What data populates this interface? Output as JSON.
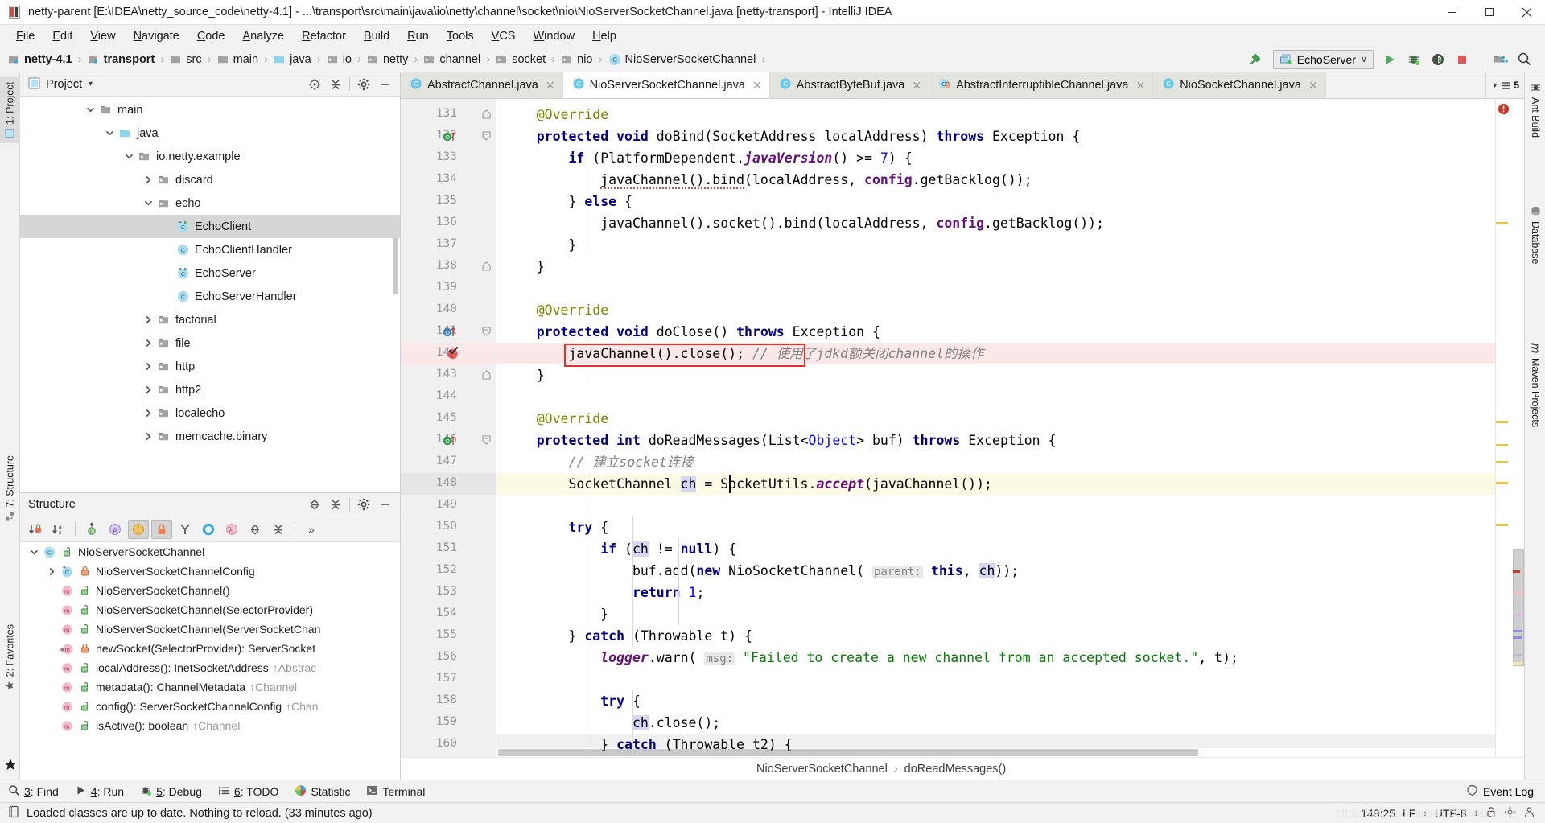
{
  "window": {
    "title": "netty-parent [E:\\IDEA\\netty_source_code\\netty-4.1] - ...\\transport\\src\\main\\java\\io\\netty\\channel\\socket\\nio\\NioServerSocketChannel.java [netty-transport] - IntelliJ IDEA",
    "minimize_label": "–",
    "maximize_label": "□",
    "close_label": "✕"
  },
  "menubar": {
    "items": [
      {
        "label": "File"
      },
      {
        "label": "Edit"
      },
      {
        "label": "View"
      },
      {
        "label": "Navigate"
      },
      {
        "label": "Code"
      },
      {
        "label": "Analyze"
      },
      {
        "label": "Refactor"
      },
      {
        "label": "Build"
      },
      {
        "label": "Run"
      },
      {
        "label": "Tools"
      },
      {
        "label": "VCS"
      },
      {
        "label": "Window"
      },
      {
        "label": "Help"
      }
    ]
  },
  "navbar": {
    "crumbs": [
      {
        "label": "netty-4.1",
        "icon": "module-icon",
        "bold": true
      },
      {
        "label": "transport",
        "icon": "module-icon",
        "bold": true
      },
      {
        "label": "src",
        "icon": "folder-icon",
        "bold": false
      },
      {
        "label": "main",
        "icon": "folder-icon",
        "bold": false
      },
      {
        "label": "java",
        "icon": "source-folder-icon",
        "bold": false
      },
      {
        "label": "io",
        "icon": "package-icon",
        "bold": false
      },
      {
        "label": "netty",
        "icon": "package-icon",
        "bold": false
      },
      {
        "label": "channel",
        "icon": "package-icon",
        "bold": false
      },
      {
        "label": "socket",
        "icon": "package-icon",
        "bold": false
      },
      {
        "label": "nio",
        "icon": "package-icon",
        "bold": false
      },
      {
        "label": "NioServerSocketChannel",
        "icon": "class-icon",
        "bold": false
      }
    ],
    "separator": "›",
    "run_config": "EchoServer",
    "run_config_caret": "∨",
    "tools": [
      "build-hammer-icon",
      "run-icon",
      "debug-icon",
      "run-with-coverage-icon",
      "stop-icon",
      "project-structure-icon",
      "search-everywhere-icon"
    ]
  },
  "left_strip": {
    "tabs": [
      {
        "label": "1: Project",
        "selected": true,
        "icon": "project-icon"
      },
      {
        "label": "7: Structure",
        "selected": false,
        "icon": "structure-icon"
      },
      {
        "label": "2: Favorites",
        "selected": false,
        "icon": "favorites-icon"
      }
    ]
  },
  "right_strip": {
    "tabs": [
      {
        "label": "Ant Build",
        "icon": "ant-icon"
      },
      {
        "label": "Database",
        "icon": "database-icon"
      },
      {
        "label": "Maven Projects",
        "icon": "maven-icon"
      }
    ]
  },
  "project_panel": {
    "title": "Project",
    "title_caret": "▾",
    "header_icons": [
      "locate-icon",
      "collapse-all-icon",
      "gear-icon",
      "hide-icon"
    ],
    "tree": [
      {
        "label": "main",
        "indent": 3,
        "twisty": "expanded",
        "icon": "folder-icon",
        "selected": false
      },
      {
        "label": "java",
        "indent": 4,
        "twisty": "expanded",
        "icon": "source-folder-icon",
        "selected": false
      },
      {
        "label": "io.netty.example",
        "indent": 5,
        "twisty": "expanded",
        "icon": "package-icon",
        "selected": false
      },
      {
        "label": "discard",
        "indent": 6,
        "twisty": "collapsed",
        "icon": "package-icon",
        "selected": false
      },
      {
        "label": "echo",
        "indent": 6,
        "twisty": "expanded",
        "icon": "package-icon",
        "selected": false
      },
      {
        "label": "EchoClient",
        "indent": 7,
        "twisty": "none",
        "icon": "runnable-class-icon",
        "selected": true
      },
      {
        "label": "EchoClientHandler",
        "indent": 7,
        "twisty": "none",
        "icon": "class-icon",
        "selected": false
      },
      {
        "label": "EchoServer",
        "indent": 7,
        "twisty": "none",
        "icon": "runnable-class-icon",
        "selected": false
      },
      {
        "label": "EchoServerHandler",
        "indent": 7,
        "twisty": "none",
        "icon": "class-icon",
        "selected": false
      },
      {
        "label": "factorial",
        "indent": 6,
        "twisty": "collapsed",
        "icon": "package-icon",
        "selected": false
      },
      {
        "label": "file",
        "indent": 6,
        "twisty": "collapsed",
        "icon": "package-icon",
        "selected": false
      },
      {
        "label": "http",
        "indent": 6,
        "twisty": "collapsed",
        "icon": "package-icon",
        "selected": false
      },
      {
        "label": "http2",
        "indent": 6,
        "twisty": "collapsed",
        "icon": "package-icon",
        "selected": false
      },
      {
        "label": "localecho",
        "indent": 6,
        "twisty": "collapsed",
        "icon": "package-icon",
        "selected": false
      },
      {
        "label": "memcache.binary",
        "indent": 6,
        "twisty": "collapsed",
        "icon": "package-icon",
        "selected": false
      }
    ]
  },
  "structure_panel": {
    "title": "Structure",
    "header_icons": [
      "expand-all-icon",
      "collapse-all-icon",
      "gear-icon",
      "hide-icon"
    ],
    "toolbar": [
      {
        "name": "sort-by-visibility-icon",
        "active": false
      },
      {
        "name": "sort-alphabetically-icon",
        "active": false
      },
      {
        "name": "show-inherited-icon",
        "active": false
      },
      {
        "name": "show-properties-icon",
        "active": false
      },
      {
        "name": "show-fields-icon",
        "active": true
      },
      {
        "name": "show-non-public-icon",
        "active": true
      },
      {
        "name": "show-anonymous-icon",
        "active": false
      },
      {
        "name": "group-by-icon",
        "active": false
      },
      {
        "name": "show-lambdas-icon",
        "active": false
      },
      {
        "name": "expand-all-icon",
        "active": false
      },
      {
        "name": "collapse-all-icon",
        "active": false
      },
      {
        "name": "more-icon",
        "active": false
      }
    ],
    "more_label": "»",
    "tree": [
      {
        "label": "NioServerSocketChannel",
        "suffix": "",
        "indent": 0,
        "twisty": "expanded",
        "icon": "class-icon",
        "lock": "public"
      },
      {
        "label": "NioServerSocketChannelConfig",
        "suffix": "",
        "indent": 1,
        "twisty": "collapsed",
        "icon": "inner-class-icon",
        "lock": "private"
      },
      {
        "label": "NioServerSocketChannel()",
        "suffix": "",
        "indent": 1,
        "twisty": "none",
        "icon": "method-icon",
        "lock": "public"
      },
      {
        "label": "NioServerSocketChannel(SelectorProvider)",
        "suffix": "",
        "indent": 1,
        "twisty": "none",
        "icon": "method-icon",
        "lock": "public"
      },
      {
        "label": "NioServerSocketChannel(ServerSocketChan",
        "suffix": "",
        "indent": 1,
        "twisty": "none",
        "icon": "method-icon",
        "lock": "public"
      },
      {
        "label": "newSocket(SelectorProvider): ServerSocket",
        "suffix": "",
        "indent": 1,
        "twisty": "none",
        "icon": "static-method-icon",
        "lock": "private"
      },
      {
        "label": "localAddress(): InetSocketAddress",
        "suffix": "↑Abstrac",
        "indent": 1,
        "twisty": "none",
        "icon": "method-icon",
        "lock": "public"
      },
      {
        "label": "metadata(): ChannelMetadata",
        "suffix": "↑Channel",
        "indent": 1,
        "twisty": "none",
        "icon": "method-icon",
        "lock": "public"
      },
      {
        "label": "config(): ServerSocketChannelConfig",
        "suffix": "↑Chan",
        "indent": 1,
        "twisty": "none",
        "icon": "method-icon",
        "lock": "public"
      },
      {
        "label": "isActive(): boolean",
        "suffix": "↑Channel",
        "indent": 1,
        "twisty": "none",
        "icon": "method-icon",
        "lock": "public"
      }
    ]
  },
  "editor": {
    "tabs": [
      {
        "label": "AbstractChannel.java",
        "icon": "class-icon",
        "active": false,
        "modified": false
      },
      {
        "label": "NioServerSocketChannel.java",
        "icon": "class-icon",
        "active": true,
        "modified": false
      },
      {
        "label": "AbstractByteBuf.java",
        "icon": "class-icon",
        "active": false,
        "modified": false
      },
      {
        "label": "AbstractInterruptibleChannel.java",
        "icon": "locked-class-icon",
        "active": false,
        "modified": false
      },
      {
        "label": "NioSocketChannel.java",
        "icon": "class-icon",
        "active": false,
        "modified": false
      }
    ],
    "tab_close": "✕",
    "tabs_overflow_count": "5",
    "first_line": 131,
    "caret_line": 148,
    "breakpoint_line": 142,
    "lines": [
      {
        "n": 131,
        "html": "    <span class=\"an\">@Override</span>",
        "fold": "end"
      },
      {
        "n": 132,
        "html": "    <span class=\"k\">protected void</span> doBind(SocketAddress localAddress) <span class=\"k\">throws</span> Exception {",
        "fold": "start",
        "gutter_icon": "override-green"
      },
      {
        "n": 133,
        "html": "        <span class=\"k\">if</span> (PlatformDependent.<span class=\"sm\">javaVersion</span>() &gt;= <span class=\"nm\">7</span>) {"
      },
      {
        "n": 134,
        "html": "            <span class=\"sqg\">javaChannel().bind</span>(localAddress, <span class=\"fi\">config</span>.getBacklog());"
      },
      {
        "n": 135,
        "html": "        } <span class=\"k\">else</span> {"
      },
      {
        "n": 136,
        "html": "            javaChannel().socket().bind(localAddress, <span class=\"fi\">config</span>.getBacklog());"
      },
      {
        "n": 137,
        "html": "        }"
      },
      {
        "n": 138,
        "html": "    }",
        "fold": "end"
      },
      {
        "n": 139,
        "html": ""
      },
      {
        "n": 140,
        "html": "    <span class=\"an\">@Override</span>"
      },
      {
        "n": 141,
        "html": "    <span class=\"k\">protected void</span> doClose() <span class=\"k\">throws</span> Exception {",
        "fold": "start",
        "gutter_icon": "override-blue"
      },
      {
        "n": 142,
        "html": "        javaChannel().close(); <span class=\"cm\">// 使用了jdkd额关闭channel的操作</span>",
        "gutter_icon": "breakpoint"
      },
      {
        "n": 143,
        "html": "    }",
        "fold": "end"
      },
      {
        "n": 144,
        "html": ""
      },
      {
        "n": 145,
        "html": "    <span class=\"an\">@Override</span>"
      },
      {
        "n": 146,
        "html": "    <span class=\"k\">protected int</span> doReadMessages(List&lt;<span class=\"ul\">Object</span>&gt; buf) <span class=\"k\">throws</span> Exception {",
        "fold": "start",
        "gutter_icon": "override-green"
      },
      {
        "n": 147,
        "html": "        <span class=\"cm\">// 建立socket连接</span>"
      },
      {
        "n": 148,
        "html": "        SocketChannel <span class=\"hl\">ch</span> = SocketUtils.<span class=\"sm\">accept</span>(javaChannel());"
      },
      {
        "n": 149,
        "html": ""
      },
      {
        "n": 150,
        "html": "        <span class=\"k\">try</span> {"
      },
      {
        "n": 151,
        "html": "            <span class=\"k\">if</span> (<span class=\"hl\">ch</span> != <span class=\"k\">null</span>) {"
      },
      {
        "n": 152,
        "html": "                buf.add(<span class=\"k\">new</span> NioSocketChannel( <span class=\"hint\">parent:</span> <span class=\"k\">this</span>, <span class=\"hl\">ch</span>));"
      },
      {
        "n": 153,
        "html": "                <span class=\"k\">return</span> <span class=\"nm\">1</span>;"
      },
      {
        "n": 154,
        "html": "            }"
      },
      {
        "n": 155,
        "html": "        } <span class=\"k\">catch</span> (Throwable t) {"
      },
      {
        "n": 156,
        "html": "            <span class=\"sm\">logger</span>.warn( <span class=\"hint\">msg:</span> <span class=\"st\">\"Failed to create a new channel from an accepted socket.\"</span>, t);"
      },
      {
        "n": 157,
        "html": ""
      },
      {
        "n": 158,
        "html": "            <span class=\"k\">try</span> {"
      },
      {
        "n": 159,
        "html": "                <span class=\"hl\">ch</span>.close();"
      },
      {
        "n": 160,
        "html": "            } <span class=\"k\">catch</span> (Throwable t2) {"
      }
    ],
    "breadcrumb": {
      "items": [
        "NioServerSocketChannel",
        "doReadMessages()"
      ],
      "separator": "›"
    },
    "error_stripe_count": "1"
  },
  "bottom_bar": {
    "items": [
      {
        "label": "3: Find",
        "icon": "search-icon",
        "mnemonic": "3"
      },
      {
        "label": "4: Run",
        "icon": "run-icon",
        "mnemonic": "4"
      },
      {
        "label": "5: Debug",
        "icon": "debug-icon",
        "mnemonic": "5"
      },
      {
        "label": "6: TODO",
        "icon": "todo-icon",
        "mnemonic": "6"
      },
      {
        "label": "Statistic",
        "icon": "statistic-icon",
        "mnemonic": ""
      },
      {
        "label": "Terminal",
        "icon": "terminal-icon",
        "mnemonic": ""
      }
    ],
    "event_log": "Event Log",
    "event_log_icon": "balloon-icon"
  },
  "status_bar": {
    "message": "Loaded classes are up to date. Nothing to reload. (33 minutes ago)",
    "message_icon": "hotswap-icon",
    "caret_position": "148:25",
    "line_separator": "LF",
    "encoding": "UTF-8",
    "lock_icon": "unlocked-icon",
    "inspection_icon": "inspections-icon",
    "memory_icon": "background-tasks-icon",
    "chevron": "↕"
  }
}
